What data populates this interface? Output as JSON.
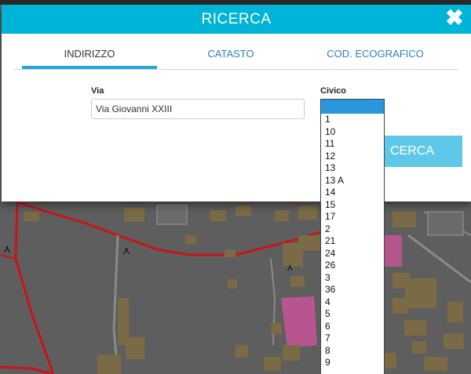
{
  "dialog": {
    "title": "RICERCA",
    "close_icon": "close-icon",
    "tabs": [
      {
        "label": "INDIRIZZO",
        "active": true
      },
      {
        "label": "CATASTO",
        "active": false
      },
      {
        "label": "COD. ECOGRAFICO",
        "active": false
      }
    ],
    "via": {
      "label": "Via",
      "value": "Via Giovanni XXIII"
    },
    "civico": {
      "label": "Civico",
      "selected": "",
      "options": [
        "",
        "1",
        "10",
        "11",
        "12",
        "13",
        "13 A",
        "14",
        "15",
        "17",
        "2",
        "21",
        "24",
        "26",
        "3",
        "36",
        "4",
        "5",
        "6",
        "7",
        "8",
        "9"
      ]
    },
    "search_button": "CERCA"
  },
  "colors": {
    "header": "#00b4d8",
    "tab_active_underline": "#1fa8e0",
    "tab_text": "#2c7fc1",
    "search_button": "#5fc8e8",
    "selected_option": "#2a97dc",
    "parcel_border": "#c8141c"
  }
}
